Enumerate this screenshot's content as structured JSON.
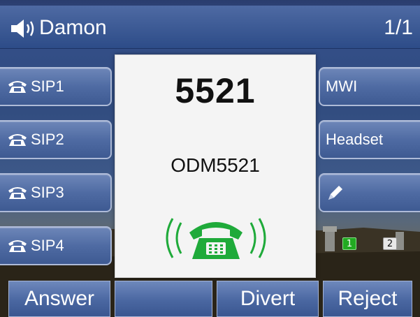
{
  "status_bar": {
    "account_name": "Damon",
    "page_indicator": "1/1",
    "speaker_icon": "speaker-volume-icon"
  },
  "line_keys_left": [
    {
      "label": "SIP1",
      "icon": "phone-icon"
    },
    {
      "label": "SIP2",
      "icon": "phone-icon"
    },
    {
      "label": "SIP3",
      "icon": "phone-icon"
    },
    {
      "label": "SIP4",
      "icon": "phone-icon"
    }
  ],
  "line_keys_right": [
    {
      "label": "MWI"
    },
    {
      "label": "Headset"
    },
    {
      "label": "",
      "icon": "pencil-icon"
    }
  ],
  "call": {
    "number": "5521",
    "name": "ODM5521",
    "state_icon": "ringing-phone-icon",
    "accent_color": "#1faa3a"
  },
  "account_indicators": [
    "1",
    "2"
  ],
  "softkeys": [
    "Answer",
    "",
    "Divert",
    "Reject"
  ]
}
